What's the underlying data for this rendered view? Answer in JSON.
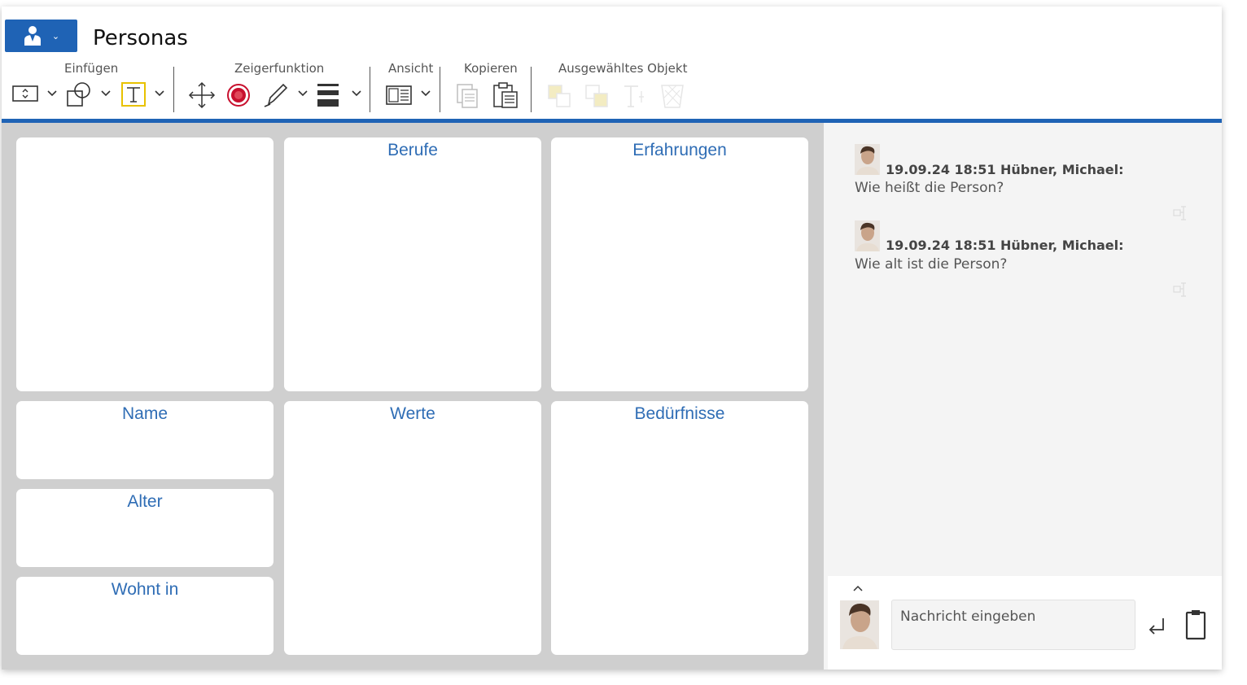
{
  "header": {
    "app_button_icon": "user-menu-icon",
    "title": "Personas"
  },
  "ribbon": {
    "groups": {
      "insert": "Einfügen",
      "pointer": "Zeigerfunktion",
      "view": "Ansicht",
      "copy": "Kopieren",
      "selected": "Ausgewähltes Objekt"
    },
    "accent_color": "#1f63b5",
    "pointer_active_color": "#c8102e",
    "highlight_color": "#e8c200"
  },
  "canvas": {
    "cards": {
      "image": "",
      "berufe": "Berufe",
      "erfahrungen": "Erfahrungen",
      "name": "Name",
      "werte": "Werte",
      "beduerfnisse": "Bedürfnisse",
      "alter": "Alter",
      "wohnt_in": "Wohnt in"
    },
    "label_color": "#2f6db5"
  },
  "chat": {
    "messages": [
      {
        "meta": "19.09.24 18:51 Hübner, Michael:",
        "text": "Wie heißt die Person?"
      },
      {
        "meta": "19.09.24 18:51 Hübner, Michael:",
        "text": "Wie alt ist die Person?"
      }
    ],
    "composer": {
      "placeholder": "Nachricht eingeben"
    }
  }
}
